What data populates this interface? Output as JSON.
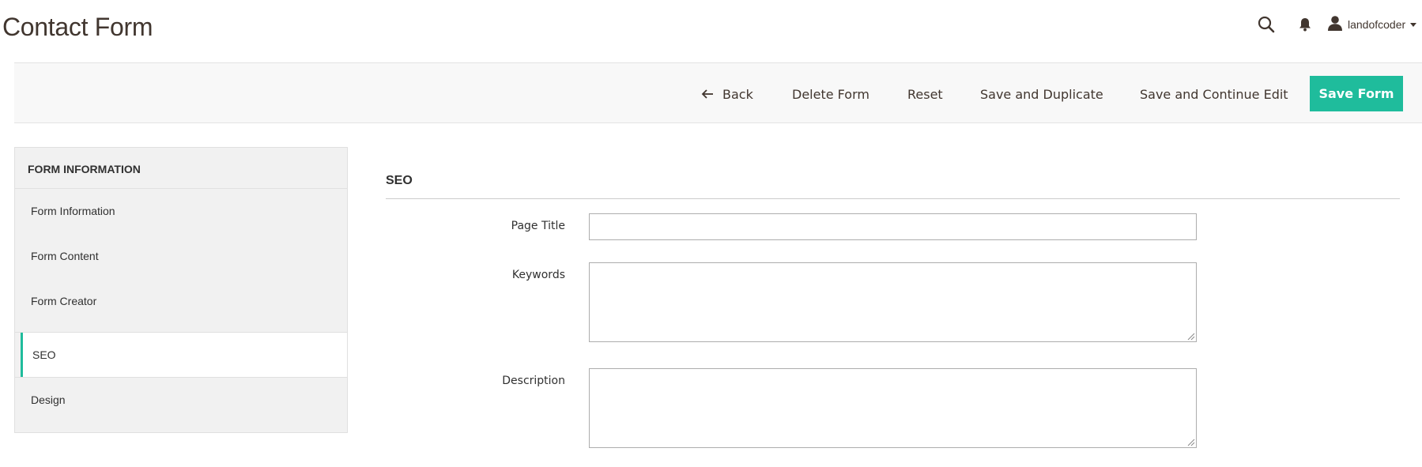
{
  "header": {
    "title": "Contact Form",
    "user_name": "landofcoder",
    "icons": [
      "search-icon",
      "bell-icon",
      "user-icon",
      "caret-down-icon"
    ]
  },
  "toolbar": {
    "back_label": "Back",
    "delete_label": "Delete Form",
    "reset_label": "Reset",
    "duplicate_label": "Save and Duplicate",
    "continue_label": "Save and Continue Edit",
    "save_label": "Save Form",
    "save_color": "#1fbc9c"
  },
  "sidebar": {
    "title": "FORM INFORMATION",
    "items": [
      {
        "label": "Form Information",
        "active": false
      },
      {
        "label": "Form Content",
        "active": false
      },
      {
        "label": "Form Creator",
        "active": false
      },
      {
        "label": "SEO",
        "active": true
      },
      {
        "label": "Design",
        "active": false
      }
    ],
    "active_color": "#1fbc9c"
  },
  "main": {
    "section_title": "SEO",
    "fields": {
      "page_title": {
        "label": "Page Title",
        "value": ""
      },
      "keywords": {
        "label": "Keywords",
        "value": ""
      },
      "description": {
        "label": "Description",
        "value": ""
      }
    }
  }
}
